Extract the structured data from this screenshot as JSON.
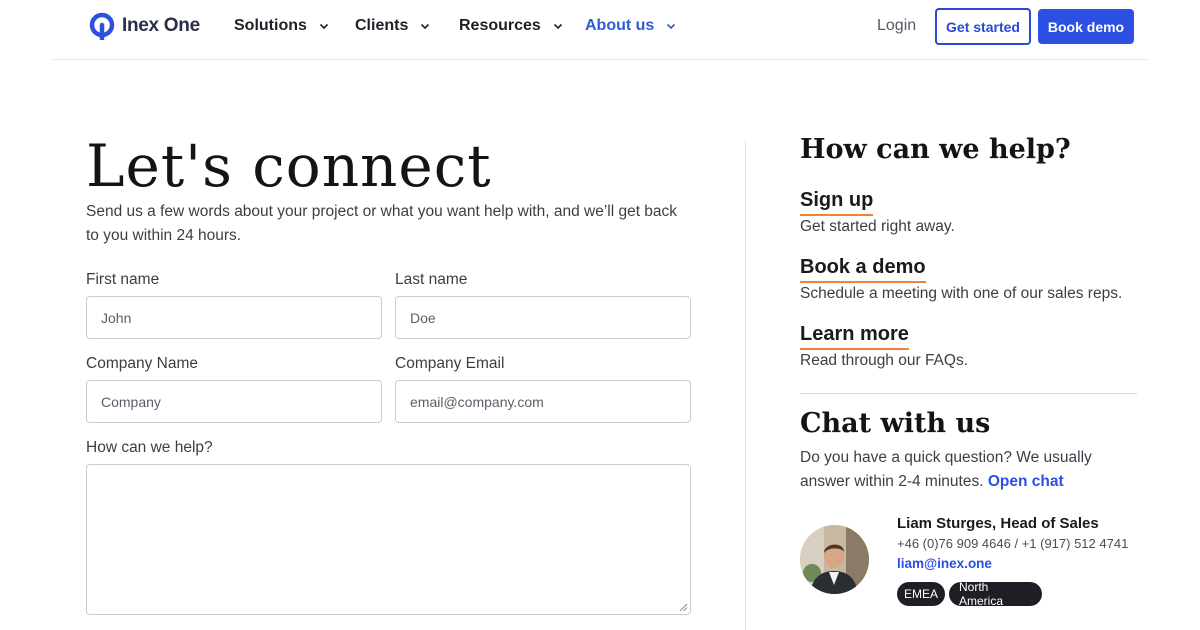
{
  "brand": {
    "name": "Inex One",
    "accent": "#2b50e3",
    "underline": "#f0833b"
  },
  "nav": {
    "items": [
      {
        "label": "Solutions",
        "active": false
      },
      {
        "label": "Clients",
        "active": false
      },
      {
        "label": "Resources",
        "active": false
      },
      {
        "label": "About us",
        "active": true
      }
    ],
    "login": "Login",
    "get_started": "Get started",
    "book_demo": "Book demo"
  },
  "contact": {
    "title": "Let's connect",
    "intro": "Send us a few words about your project or what you want help with, and we’ll get back to you within 24 hours.",
    "fields": {
      "first_name": {
        "label": "First name",
        "placeholder": "John"
      },
      "last_name": {
        "label": "Last name",
        "placeholder": "Doe"
      },
      "company_name": {
        "label": "Company Name",
        "placeholder": "Company"
      },
      "company_email": {
        "label": "Company Email",
        "placeholder": "email@company.com"
      },
      "message": {
        "label": "How can we help?"
      }
    }
  },
  "help": {
    "title": "How can we help?",
    "links": [
      {
        "title": "Sign up",
        "desc": "Get started right away."
      },
      {
        "title": "Book a demo",
        "desc": "Schedule a meeting with one of our sales reps."
      },
      {
        "title": "Learn more",
        "desc": "Read through our FAQs."
      }
    ]
  },
  "chat": {
    "title": "Chat with us",
    "desc": "Do you have a quick question? We usually answer within 2-4 minutes.",
    "link": "Open chat"
  },
  "person": {
    "name": "Liam Sturges, Head of Sales",
    "phone": "+46 (0)76 909 4646 / +1 (917) 512 4741",
    "email": "liam@inex.one",
    "tags": [
      "EMEA",
      "North America"
    ]
  }
}
